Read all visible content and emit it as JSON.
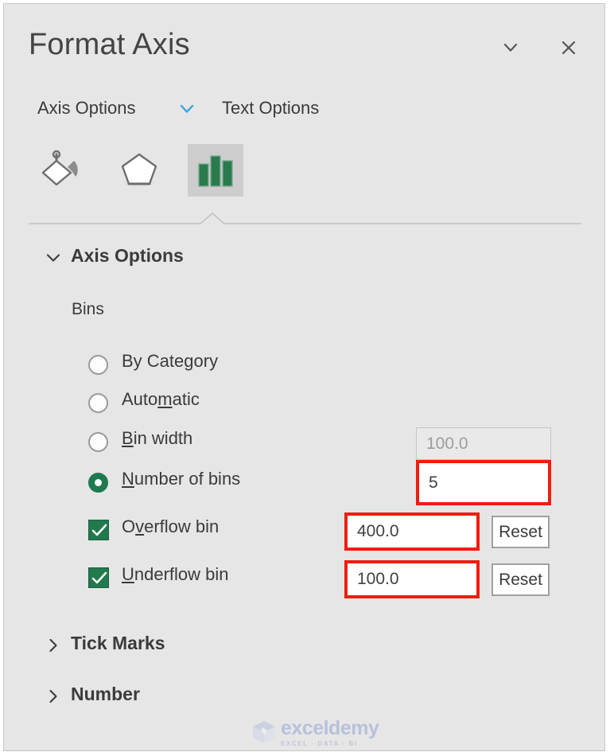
{
  "pane": {
    "title": "Format Axis",
    "collapse_icon": "chevron-down-icon",
    "close_icon": "close-icon"
  },
  "option_tabs": [
    {
      "label": "Axis Options",
      "selected": true,
      "caret_icon": "chevron-down-icon"
    },
    {
      "label": "Text Options",
      "selected": false
    }
  ],
  "icon_tabs": [
    {
      "name": "fill-and-line-icon",
      "selected": false
    },
    {
      "name": "effects-icon",
      "selected": false
    },
    {
      "name": "axis-options-icon",
      "selected": true
    }
  ],
  "sections": {
    "axis_options": {
      "label": "Axis Options",
      "expanded": true,
      "chevron": "chevron-down-icon"
    },
    "tick_marks": {
      "label": "Tick Marks",
      "expanded": false,
      "chevron": "chevron-right-icon"
    },
    "number": {
      "label": "Number",
      "expanded": false,
      "chevron": "chevron-right-icon"
    }
  },
  "bins": {
    "group_label": "Bins",
    "by_category": {
      "label": "By Category",
      "selected": false
    },
    "automatic": {
      "label": "Automatic",
      "selected": false
    },
    "bin_width": {
      "label": "Bin width",
      "selected": false,
      "value": "100.0",
      "disabled": true
    },
    "number_of_bins": {
      "label": "Number of bins",
      "selected": true,
      "value": "5",
      "highlighted": true
    },
    "overflow_bin": {
      "label": "Overflow bin",
      "checked": true,
      "value": "400.0",
      "highlighted": true,
      "reset_label": "Reset"
    },
    "underflow_bin": {
      "label": "Underflow bin",
      "checked": true,
      "value": "100.0",
      "highlighted": true,
      "reset_label": "Reset"
    }
  },
  "watermark": {
    "name": "exceldemy",
    "tagline": "EXCEL · DATA · BI"
  },
  "colors": {
    "pane_background": "#e6e6e6",
    "accent_green": "#21794c",
    "highlight_red": "#f41b10",
    "tab_caret_blue": "#3da7dc",
    "text": "#3b3b3b"
  }
}
